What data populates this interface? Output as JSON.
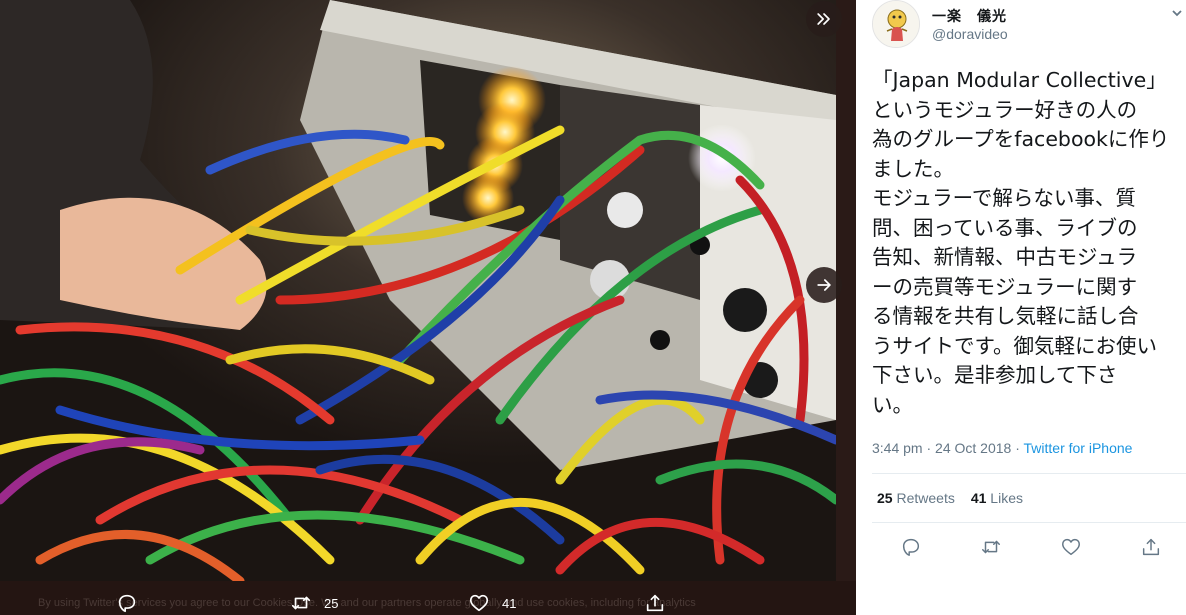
{
  "media": {
    "photo_alt": "",
    "cookie_text": "By using Twitter's services you agree to our Cookies Use. We and our partners operate globally and use cookies, including for analytics",
    "actions": {
      "reply_count": "",
      "retweet_count": "25",
      "like_count": "41"
    },
    "icons": {
      "collapse": "double-chevron-right-icon",
      "next": "arrow-right-icon",
      "reply": "reply-icon",
      "retweet": "retweet-icon",
      "like": "heart-icon",
      "share": "share-icon"
    }
  },
  "tweet": {
    "display_name": "一楽　儀光",
    "handle": "@doravideo",
    "text_lines": [
      "「Japan Modular Collective」",
      "というモジュラー好きの人の",
      "為のグループをfacebookに作り",
      "ました。",
      "モジュラーで解らない事、質",
      "問、困っている事、ライブの",
      "告知、新情報、中古モジュラ",
      "ーの売買等モジュラーに関す",
      "る情報を共有し気軽に話し合",
      "うサイトです。御気軽にお使い",
      "下さい。是非参加して下さ",
      "い。"
    ],
    "time": "3:44 pm · 24 Oct 2018",
    "separator": " · ",
    "source": "Twitter for iPhone",
    "retweets_count": "25",
    "retweets_label": "Retweets",
    "likes_count": "41",
    "likes_label": "Likes"
  },
  "colors": {
    "text": "#14171a",
    "secondary": "#657786",
    "link": "#1b95e0",
    "panel_bg": "#ffffff",
    "media_bg": "#241512"
  }
}
